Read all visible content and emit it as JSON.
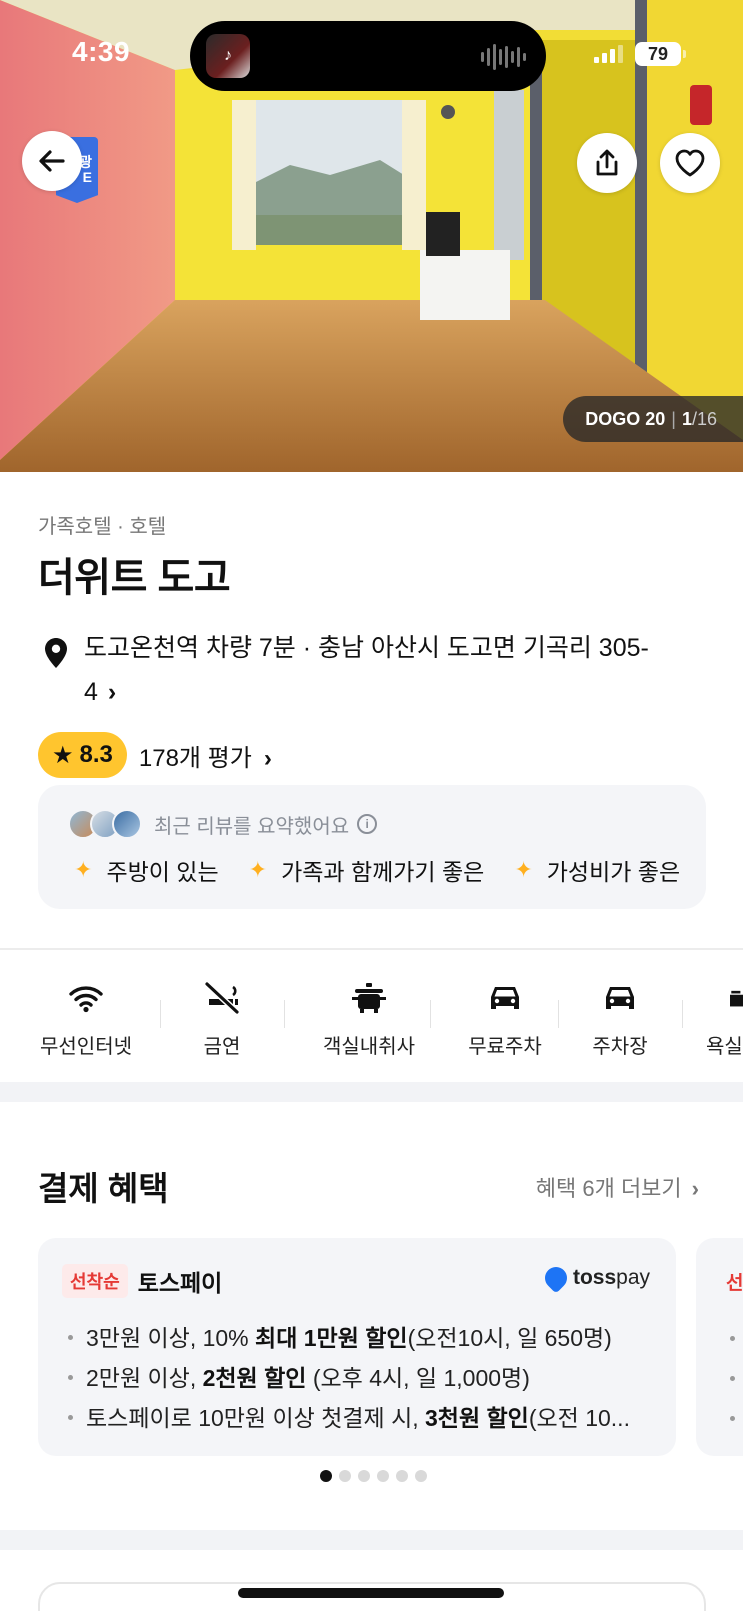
{
  "status_bar": {
    "time": "4:39",
    "battery": "79"
  },
  "hero": {
    "photo_brand": "DOGO 20",
    "photo_index": "1",
    "photo_total": "/16",
    "tag_text_1": "관광",
    "tag_text_2": "E"
  },
  "info": {
    "category": "가족호텔 · 호텔",
    "name": "더위트 도고",
    "address_line1": "도고온천역 차량 7분 · 충남 아산시 도고면 기곡리 305-",
    "address_line2": "4",
    "rating": "8.3",
    "review_count": "178개 평가"
  },
  "review_summary": {
    "title": "최근 리뷰를 요약했어요",
    "keywords": [
      "주방이 있는",
      "가족과 함께가기 좋은",
      "가성비가 좋은"
    ]
  },
  "amenities": [
    {
      "label": "무선인터넷",
      "icon": "wifi-icon"
    },
    {
      "label": "금연",
      "icon": "no-smoking-icon"
    },
    {
      "label": "객실내취사",
      "icon": "cooking-icon"
    },
    {
      "label": "무료주차",
      "icon": "car-icon"
    },
    {
      "label": "주차장",
      "icon": "car-icon"
    },
    {
      "label": "욕실",
      "icon": "bath-icon"
    }
  ],
  "benefits": {
    "title": "결제 혜택",
    "more_label": "혜택 6개 더보기",
    "card": {
      "tag": "선착순",
      "name": "토스페이",
      "logo_text_1": "toss",
      "logo_text_2": "pay",
      "items": [
        {
          "pre": "3만원 이상, 10% ",
          "bold": "최대 1만원 할인",
          "post": "(오전10시, 일 650명)"
        },
        {
          "pre": "2만원 이상, ",
          "bold": "2천원 할인",
          "post": " (오후 4시, 일 1,000명)"
        },
        {
          "pre": "토스페이로 10만원 이상 첫결제 시, ",
          "bold": "3천원 할인",
          "post": "(오전 10..."
        }
      ]
    },
    "peek_tag": "선",
    "page_count": 6,
    "active_page": 1
  },
  "colors": {
    "accent_yellow": "#ffc52e",
    "badge_red": "#e53935",
    "toss_blue": "#1d74f5"
  }
}
